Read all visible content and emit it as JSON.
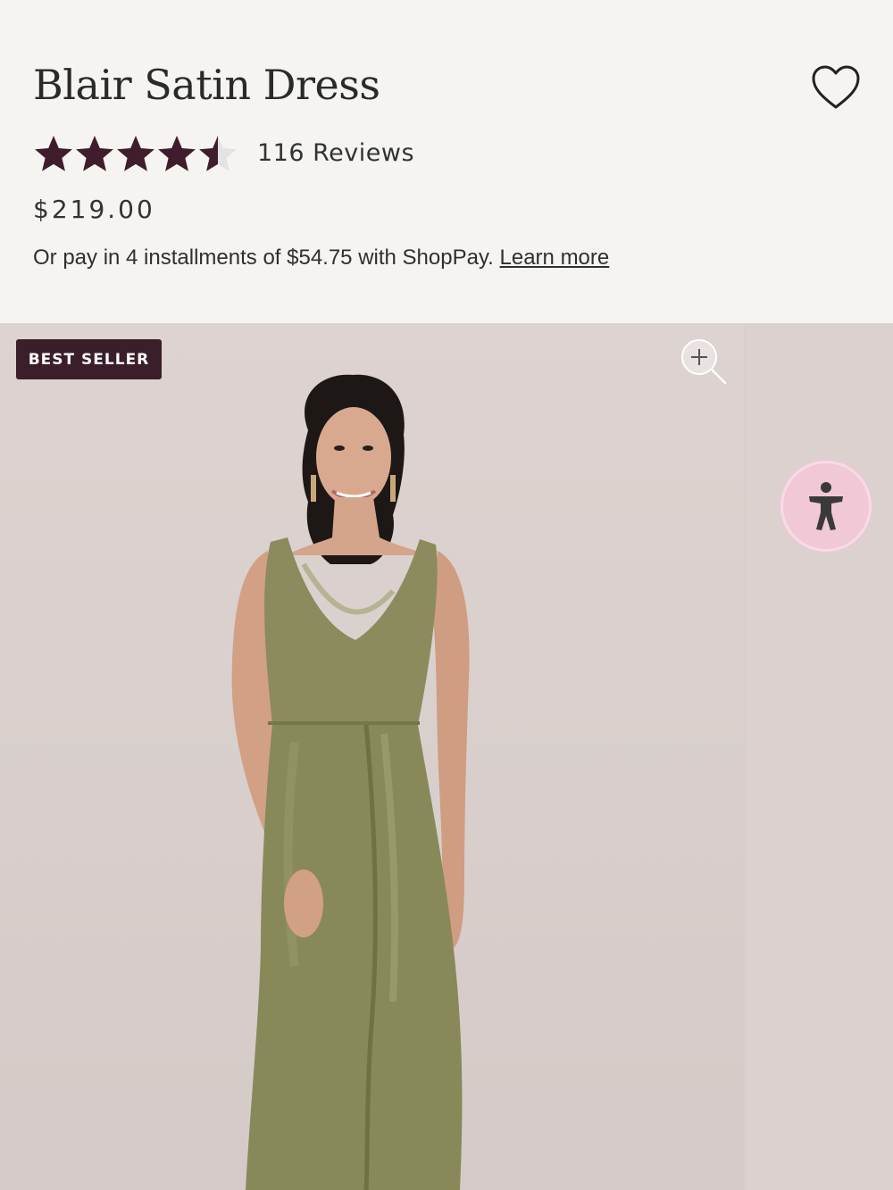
{
  "product": {
    "title": "Blair Satin Dress",
    "rating": 4.5,
    "rating_max": 5,
    "reviews_label": "116 Reviews",
    "price": "$219.00",
    "installments_text": "Or pay in 4 installments of $54.75 with ShopPay.",
    "learn_more_label": "Learn more"
  },
  "gallery": {
    "badge_label": "BEST SELLER"
  },
  "icons": {
    "wishlist": "heart-icon",
    "zoom": "zoom-plus-icon",
    "accessibility": "accessibility-icon",
    "star": "star-icon"
  },
  "colors": {
    "star_fill": "#3f1d2c",
    "star_empty": "#e3e2e4",
    "badge_bg": "#3a1f2b",
    "background": "#f5f4f1",
    "dress": "#8a8a5c",
    "accessibility_button": "#f1c8d6"
  }
}
